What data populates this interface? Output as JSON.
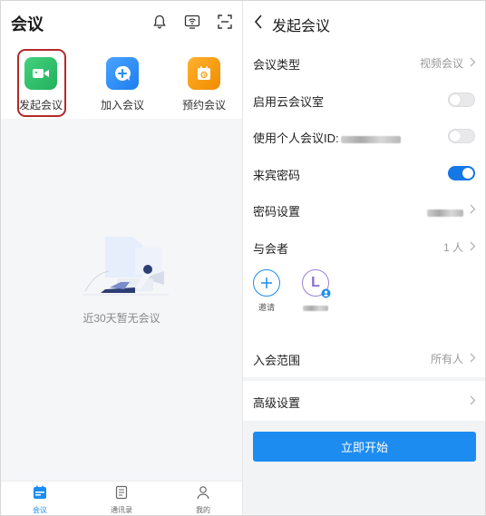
{
  "left": {
    "title": "会议",
    "header_icons": [
      "bell-icon",
      "screen-share-icon",
      "scan-icon"
    ],
    "quick_actions": [
      {
        "label": "发起会议",
        "icon": "video-camera-icon",
        "color": "#2cbf6b"
      },
      {
        "label": "加入会议",
        "icon": "plus-icon",
        "color": "#2a8cf4"
      },
      {
        "label": "预约会议",
        "icon": "calendar-icon",
        "color": "#f49b12"
      }
    ],
    "empty_text": "近30天暂无会议",
    "tabs": [
      {
        "label": "会议",
        "icon": "meeting-tab-icon",
        "active": true
      },
      {
        "label": "通讯录",
        "icon": "contacts-tab-icon",
        "active": false
      },
      {
        "label": "我的",
        "icon": "profile-tab-icon",
        "active": false
      }
    ]
  },
  "right": {
    "title": "发起会议",
    "rows": {
      "meeting_type": {
        "label": "会议类型",
        "value": "视频会议"
      },
      "cloud_room": {
        "label": "启用云会议室",
        "toggle": false
      },
      "personal_id": {
        "label": "使用个人会议ID:",
        "toggle": false
      },
      "guest_password": {
        "label": "来宾密码",
        "toggle": true
      },
      "password_settings": {
        "label": "密码设置"
      },
      "participants": {
        "label": "与会者",
        "value": "1 人"
      }
    },
    "participants_list": {
      "invite_label": "邀请",
      "avatar_letter": "L"
    },
    "join_scope": {
      "label": "入会范围",
      "value": "所有人"
    },
    "advanced": {
      "label": "高级设置"
    },
    "start_button": "立即开始"
  },
  "colors": {
    "accent": "#1d8cf0",
    "toggle_on": "#1677e6",
    "highlight_border": "#b22a2a"
  }
}
